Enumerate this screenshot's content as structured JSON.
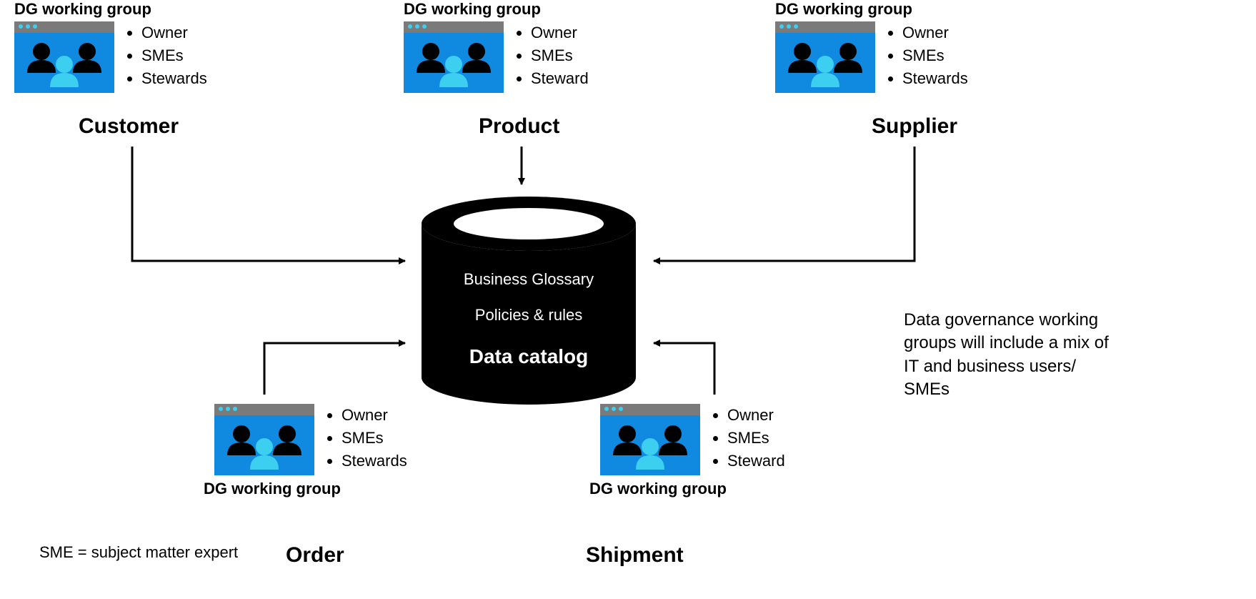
{
  "working_group_label": "DG working group",
  "cylinder": {
    "line1": "Business Glossary",
    "line2": "Policies & rules",
    "line3": "Data catalog"
  },
  "side_note": "Data governance working groups will include a mix of IT and business users/ SMEs",
  "footnote": "SME = subject matter expert",
  "groups": {
    "customer": {
      "domain": "Customer",
      "roles": [
        "Owner",
        "SMEs",
        "Stewards"
      ]
    },
    "product": {
      "domain": "Product",
      "roles": [
        "Owner",
        "SMEs",
        "Steward"
      ]
    },
    "supplier": {
      "domain": "Supplier",
      "roles": [
        "Owner",
        "SMEs",
        "Stewards"
      ]
    },
    "order": {
      "domain": "Order",
      "roles": [
        "Owner",
        "SMEs",
        "Stewards"
      ]
    },
    "shipment": {
      "domain": "Shipment",
      "roles": [
        "Owner",
        "SMEs",
        "Steward"
      ]
    }
  }
}
